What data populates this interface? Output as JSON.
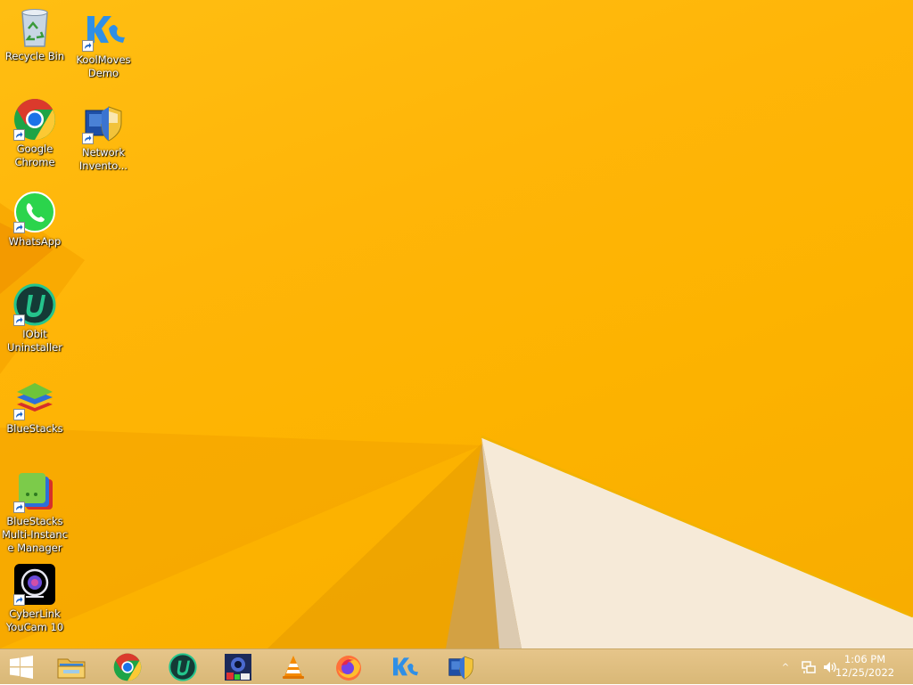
{
  "desktop_icons": [
    {
      "label": "Recycle Bin",
      "icon": "recycle-bin-icon"
    },
    {
      "label": "KoolMoves\nDemo",
      "icon": "koolmoves-icon"
    },
    {
      "label": "Google\nChrome",
      "icon": "chrome-icon"
    },
    {
      "label": "Network\nInvento...",
      "icon": "network-inventory-icon"
    },
    {
      "label": "WhatsApp",
      "icon": "whatsapp-icon"
    },
    {
      "label": "IObit\nUninstaller",
      "icon": "iobit-uninstaller-icon"
    },
    {
      "label": "BlueStacks",
      "icon": "bluestacks-icon"
    },
    {
      "label": "BlueStacks\nMulti-Instanc\ne Manager",
      "icon": "bluestacks-multi-instance-icon"
    },
    {
      "label": "CyberLink\nYouCam 10",
      "icon": "cyberlink-youcam-icon"
    }
  ],
  "taskbar": {
    "start": "windows-start-icon",
    "pinned": [
      "file-explorer-icon",
      "chrome-icon",
      "iobit-uninstaller-icon",
      "photo-app-icon",
      "vlc-icon",
      "firefox-icon",
      "koolmoves-icon",
      "network-inventory-icon"
    ]
  },
  "tray": {
    "chevron": "^",
    "icons": [
      "network-icon",
      "volume-icon"
    ]
  },
  "clock": {
    "time": "1:06 PM",
    "date": "12/25/2022"
  },
  "colors": {
    "wallpaper": "#fdb300",
    "taskbar": "#dfbe80"
  }
}
